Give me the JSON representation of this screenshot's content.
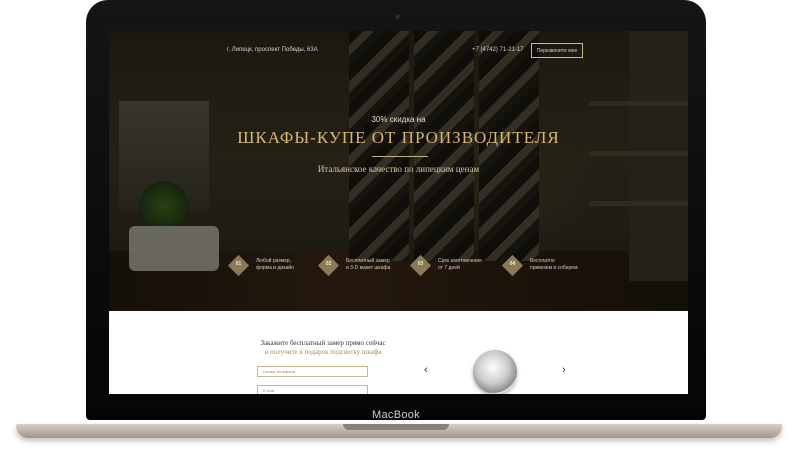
{
  "device": {
    "brand": "MacBook"
  },
  "header": {
    "address": "г. Липецк, проспект Победы, 63А",
    "phone": "+7 (4742) 71-21-17",
    "callback_label": "Перезвоните мне"
  },
  "hero": {
    "pretitle": "30% скидка на",
    "title": "ШКАФЫ-КУПЕ ОТ ПРОИЗВОДИТЕЛЯ",
    "subtitle": "Итальянское качество по липецким ценам"
  },
  "features": [
    {
      "num": "01",
      "line1": "Любой размер,",
      "line2": "форма и дизайн"
    },
    {
      "num": "02",
      "line1": "Бесплатный замер",
      "line2": "и 3-D макет шкафа"
    },
    {
      "num": "03",
      "line1": "Срок изготовления",
      "line2": "от 7 дней"
    },
    {
      "num": "04",
      "line1": "Бесплатно",
      "line2": "привезем и соберем"
    }
  ],
  "order": {
    "heading1": "Закажите бесплатный замер прямо сейчас",
    "heading2": "и получите в подарок подсветку шкафа",
    "phone_placeholder": "Номер телефона",
    "email_placeholder": "E-mail"
  },
  "carousel": {
    "prev": "‹",
    "next": "›"
  },
  "colors": {
    "accent_gold": "#d8b86c",
    "diamond": "#8a7a56",
    "field_border": "#c8b88f"
  }
}
